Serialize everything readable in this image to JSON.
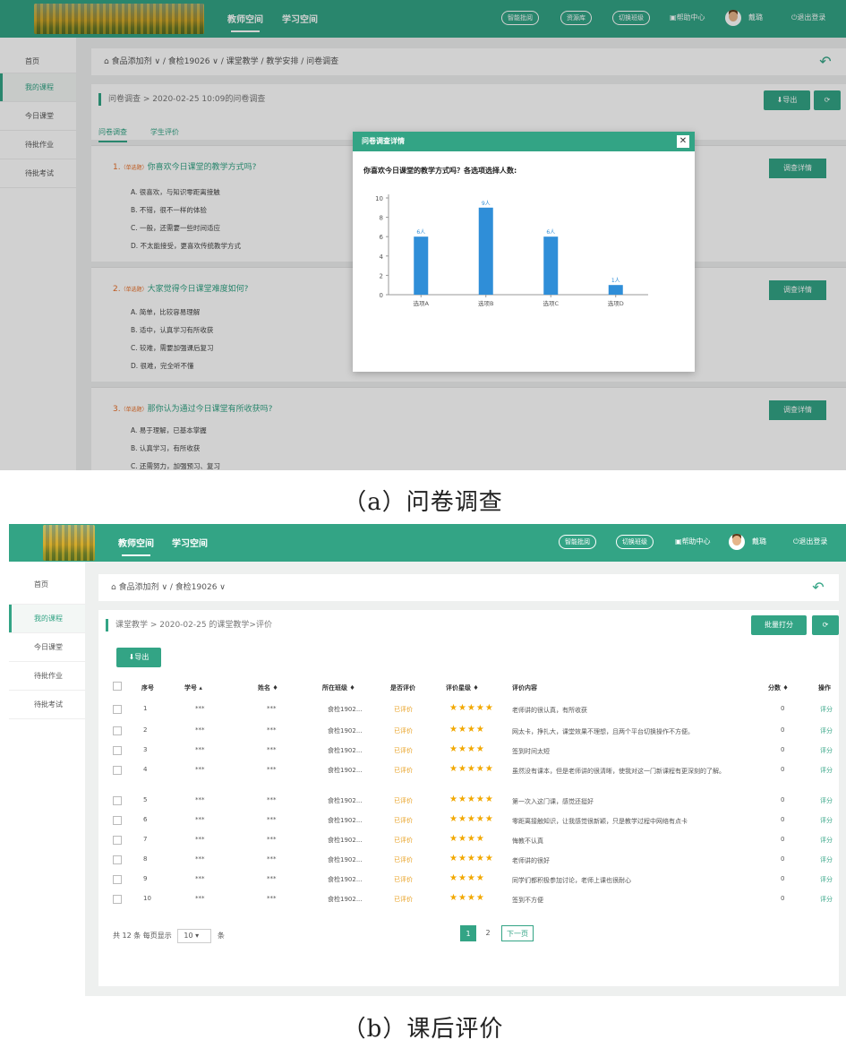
{
  "colors": {
    "brand": "#33a485",
    "star": "#f2a800",
    "status": "#e8a020",
    "bar": "#2f8ed8"
  },
  "captions": {
    "a": "（a）问卷调查",
    "b": "（b）课后评价"
  },
  "a": {
    "nav": [
      "教师空间",
      "学习空间"
    ],
    "pills": [
      "智能批阅",
      "资源库",
      "切换班级"
    ],
    "help": "帮助中心",
    "user": "戴璐",
    "logout": "退出登录",
    "sidebar": [
      "首页",
      "我的课程",
      "今日课堂",
      "待批作业",
      "待批考试"
    ],
    "breadcrumb": "食品添加剂 ∨ / 食检19026 ∨ / 课堂教学 / 教学安排 / 问卷调查",
    "panel_title": "问卷调查 > 2020-02-25 10:09的问卷调查",
    "export": "导出",
    "tabs": [
      "问卷调查",
      "学生评价"
    ],
    "questions": [
      {
        "num": "1.",
        "tag": "（单选题）",
        "text": "你喜欢今日课堂的教学方式吗?",
        "options": [
          "A. 很喜欢，与知识零距离接触",
          "B. 不错，很不一样的体验",
          "C. 一般，还需要一些时间适应",
          "D. 不太能接受，更喜欢传统教学方式"
        ],
        "btn": "调查详情"
      },
      {
        "num": "2.",
        "tag": "（单选题）",
        "text": "大家觉得今日课堂难度如何?",
        "options": [
          "A. 简单，比较容易理解",
          "B. 适中，认真学习有所收获",
          "C. 较难，需要加强课后复习",
          "D. 很难，完全听不懂"
        ],
        "btn": "调查详情"
      },
      {
        "num": "3.",
        "tag": "（单选题）",
        "text": "那你认为通过今日课堂有所收获吗?",
        "options": [
          "A. 易于理解，已基本掌握",
          "B. 认真学习，有所收获",
          "C. 还需努力，加强预习、复习"
        ],
        "btn": "调查详情"
      }
    ],
    "modal": {
      "title": "问卷调查详情",
      "question": "你喜欢今日课堂的教学方式吗？各选项选择人数:"
    }
  },
  "chart_data": {
    "type": "bar",
    "categories": [
      "选项A",
      "选项B",
      "选项C",
      "选项D"
    ],
    "values": [
      6,
      9,
      6,
      1
    ],
    "data_labels": [
      "6人",
      "9人",
      "6人",
      "1人"
    ],
    "title": "",
    "xlabel": "",
    "ylabel": "",
    "ylim": [
      0,
      10
    ],
    "yticks": [
      0,
      2,
      4,
      6,
      8,
      10
    ],
    "grid": false
  },
  "b": {
    "nav": [
      "教师空间",
      "学习空间"
    ],
    "pills": [
      "智能批阅",
      "切换班级"
    ],
    "help": "帮助中心",
    "user": "戴璐",
    "logout": "退出登录",
    "sidebar": [
      "首页",
      "我的课程",
      "今日课堂",
      "待批作业",
      "待批考试"
    ],
    "breadcrumb": "食品添加剂 ∨ / 食检19026 ∨",
    "panel_title": "课堂教学 > 2020-02-25 的课堂教学>评价",
    "batch": "批量打分",
    "export": "导出",
    "headers": [
      "序号",
      "学号 ▴",
      "姓名 ♦",
      "所在班级 ♦",
      "是否评价",
      "评价星级 ♦",
      "评价内容",
      "分数 ♦",
      "操作"
    ],
    "rows": [
      {
        "no": "1",
        "id": "***",
        "name": "***",
        "cls": "食检1902...",
        "status": "已评价",
        "stars": "★★★★★",
        "content": "老师讲的很认真，有所收获",
        "score": "0",
        "op": "评分"
      },
      {
        "no": "2",
        "id": "***",
        "name": "***",
        "cls": "食检1902...",
        "status": "已评价",
        "stars": "★★★★",
        "content": "网太卡，挣扎大，课堂效果不理想，且两个平台切换操作不方便。",
        "score": "0",
        "op": "评分"
      },
      {
        "no": "3",
        "id": "***",
        "name": "***",
        "cls": "食检1902...",
        "status": "已评价",
        "stars": "★★★★",
        "content": "签到时间太短",
        "score": "0",
        "op": "评分"
      },
      {
        "no": "4",
        "id": "***",
        "name": "***",
        "cls": "食检1902...",
        "status": "已评价",
        "stars": "★★★★★",
        "content": "虽然没有课本，但是老师讲的很清晰，使我对这一门新课程有更深刻的了解。",
        "score": "0",
        "op": "评分"
      },
      {
        "no": "5",
        "id": "***",
        "name": "***",
        "cls": "食检1902...",
        "status": "已评价",
        "stars": "★★★★★",
        "content": "第一次入这门课，感觉还挺好",
        "score": "0",
        "op": "评分"
      },
      {
        "no": "6",
        "id": "***",
        "name": "***",
        "cls": "食检1902...",
        "status": "已评价",
        "stars": "★★★★★",
        "content": "零距离接触知识，让我感觉很新颖，只是教学过程中网络有点卡",
        "score": "0",
        "op": "评分"
      },
      {
        "no": "7",
        "id": "***",
        "name": "***",
        "cls": "食检1902...",
        "status": "已评价",
        "stars": "★★★★",
        "content": "悔教不认真",
        "score": "0",
        "op": "评分"
      },
      {
        "no": "8",
        "id": "***",
        "name": "***",
        "cls": "食检1902...",
        "status": "已评价",
        "stars": "★★★★★",
        "content": "老师讲的很好",
        "score": "0",
        "op": "评分"
      },
      {
        "no": "9",
        "id": "***",
        "name": "***",
        "cls": "食检1902...",
        "status": "已评价",
        "stars": "★★★★",
        "content": "同学们都积极参加讨论，老师上课也很耐心",
        "score": "0",
        "op": "评分"
      },
      {
        "no": "10",
        "id": "***",
        "name": "***",
        "cls": "食检1902...",
        "status": "已评价",
        "stars": "★★★★",
        "content": "签到不方便",
        "score": "0",
        "op": "评分"
      }
    ],
    "footer": {
      "total": "共 12 条 每页显示",
      "per_page": "10",
      "unit": "条",
      "pages": [
        "1",
        "2"
      ],
      "next": "下一页"
    }
  }
}
